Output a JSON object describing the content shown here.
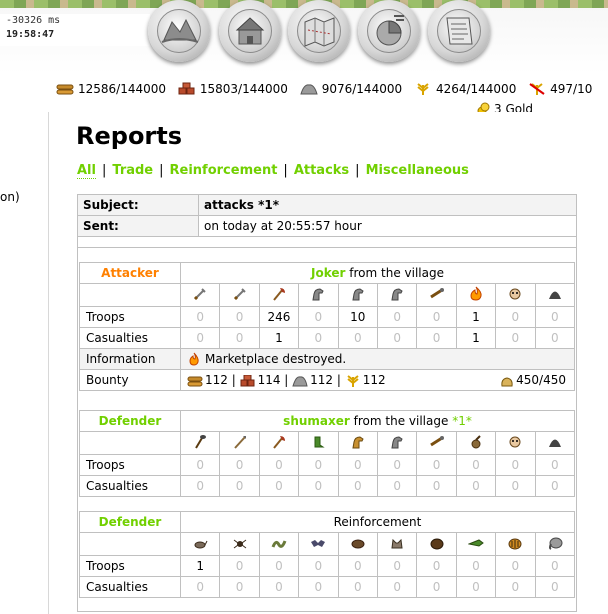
{
  "timeinfo": {
    "ms": "-30326 ms",
    "clock": "19:58:47"
  },
  "nav": [
    {
      "name": "village-overview",
      "icon": "fields-icon"
    },
    {
      "name": "village-center",
      "icon": "village-center-icon"
    },
    {
      "name": "map",
      "icon": "map-icon"
    },
    {
      "name": "statistics",
      "icon": "statistics-icon"
    },
    {
      "name": "reports",
      "icon": "reports-icon"
    }
  ],
  "resources": {
    "lumber": "12586/144000",
    "clay": "15803/144000",
    "iron": "9076/144000",
    "crop": "4264/144000",
    "crop_consumption": "497/10"
  },
  "gold": "3 Gold",
  "side_fragment": "on)",
  "page": {
    "title": "Reports",
    "tabs": [
      "All",
      "Trade",
      "Reinforcement",
      "Attacks",
      "Miscellaneous"
    ]
  },
  "report": {
    "subject_label": "Subject:",
    "subject": "attacks *1*",
    "sent_label": "Sent:",
    "sent": "on today at 20:55:57 hour"
  },
  "attacker": {
    "role": "Attacker",
    "player": "Joker",
    "from_text": "from the village",
    "unit_icons": [
      "sword-icon",
      "sword-icon",
      "axe-icon",
      "horse-icon",
      "horse-icon",
      "horse-icon",
      "ram-icon",
      "catapult-fire-icon",
      "chief-icon",
      "settler-icon"
    ],
    "troops_label": "Troops",
    "troops": [
      "0",
      "0",
      "246",
      "0",
      "10",
      "0",
      "0",
      "1",
      "0",
      "0"
    ],
    "casualties_label": "Casualties",
    "casualties": [
      "0",
      "0",
      "1",
      "0",
      "0",
      "0",
      "0",
      "1",
      "0",
      "0"
    ],
    "info_label": "Information",
    "info_text": "Marketplace destroyed.",
    "bounty_label": "Bounty",
    "bounty": {
      "lumber": "112",
      "clay": "114",
      "iron": "112",
      "crop": "112",
      "carry": "450/450"
    }
  },
  "defender": {
    "role": "Defender",
    "player": "shumaxer",
    "from_text": "from the village",
    "village": "*1*",
    "unit_icons": [
      "club-icon",
      "spear-icon",
      "axe-icon",
      "scout-icon",
      "paladin-icon",
      "horse-icon",
      "ram-icon",
      "catapult-icon",
      "chief-icon",
      "settler-icon"
    ],
    "troops_label": "Troops",
    "troops": [
      "0",
      "0",
      "0",
      "0",
      "0",
      "0",
      "0",
      "0",
      "0",
      "0"
    ],
    "casualties_label": "Casualties",
    "casualties": [
      "0",
      "0",
      "0",
      "0",
      "0",
      "0",
      "0",
      "0",
      "0",
      "0"
    ]
  },
  "reinforcement": {
    "role": "Defender",
    "title": "Reinforcement",
    "unit_icons": [
      "rat-icon",
      "spider-icon",
      "snake-icon",
      "bat-icon",
      "boar-icon",
      "wolf-icon",
      "bear-icon",
      "crocodile-icon",
      "tiger-icon",
      "elephant-icon"
    ],
    "troops_label": "Troops",
    "troops": [
      "1",
      "0",
      "0",
      "0",
      "0",
      "0",
      "0",
      "0",
      "0",
      "0"
    ],
    "casualties_label": "Casualties",
    "casualties": [
      "0",
      "0",
      "0",
      "0",
      "0",
      "0",
      "0",
      "0",
      "0",
      "0"
    ]
  },
  "colors": {
    "accent": "#71d000",
    "attacker": "#ff8000",
    "muted": "#c0c0c0"
  }
}
